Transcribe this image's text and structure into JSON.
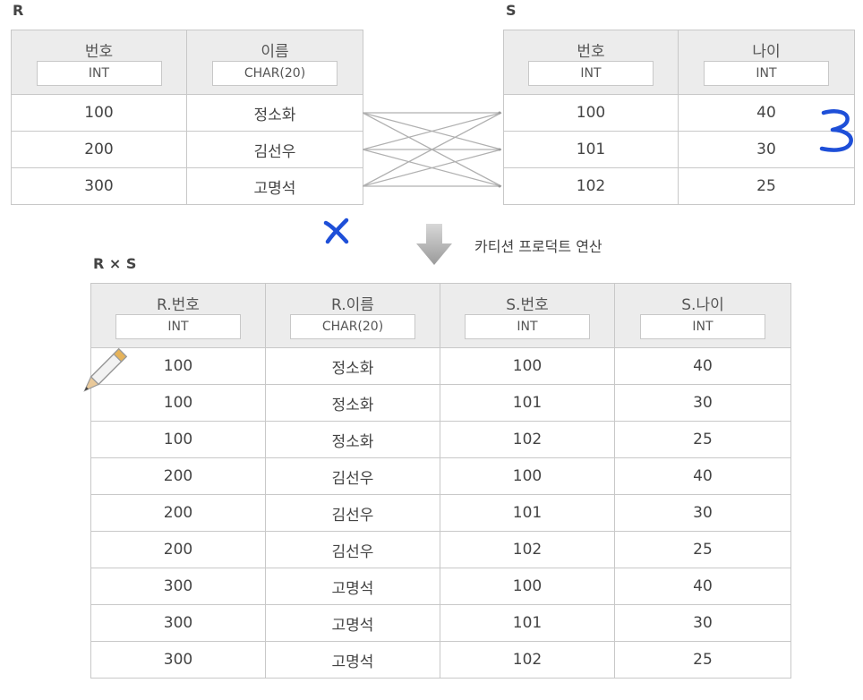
{
  "relation_r": {
    "label": "R",
    "columns": [
      {
        "name": "번호",
        "type": "INT"
      },
      {
        "name": "이름",
        "type": "CHAR(20)"
      }
    ],
    "rows": [
      [
        "100",
        "정소화"
      ],
      [
        "200",
        "김선우"
      ],
      [
        "300",
        "고명석"
      ]
    ]
  },
  "relation_s": {
    "label": "S",
    "columns": [
      {
        "name": "번호",
        "type": "INT"
      },
      {
        "name": "나이",
        "type": "INT"
      }
    ],
    "rows": [
      [
        "100",
        "40"
      ],
      [
        "101",
        "30"
      ],
      [
        "102",
        "25"
      ]
    ]
  },
  "operation": {
    "label": "카티션 프로덕트 연산"
  },
  "result": {
    "label": "R × S",
    "columns": [
      {
        "name": "R.번호",
        "type": "INT"
      },
      {
        "name": "R.이름",
        "type": "CHAR(20)"
      },
      {
        "name": "S.번호",
        "type": "INT"
      },
      {
        "name": "S.나이",
        "type": "INT"
      }
    ],
    "rows": [
      [
        "100",
        "정소화",
        "100",
        "40"
      ],
      [
        "100",
        "정소화",
        "101",
        "30"
      ],
      [
        "100",
        "정소화",
        "102",
        "25"
      ],
      [
        "200",
        "김선우",
        "100",
        "40"
      ],
      [
        "200",
        "김선우",
        "101",
        "30"
      ],
      [
        "200",
        "김선우",
        "102",
        "25"
      ],
      [
        "300",
        "고명석",
        "100",
        "40"
      ],
      [
        "300",
        "고명석",
        "101",
        "30"
      ],
      [
        "300",
        "고명석",
        "102",
        "25"
      ]
    ]
  },
  "annotations": {
    "x_mark": "x",
    "three_mark": "3",
    "ink_color": "#1e4fd8",
    "pencil_icon": "pencil-icon"
  }
}
